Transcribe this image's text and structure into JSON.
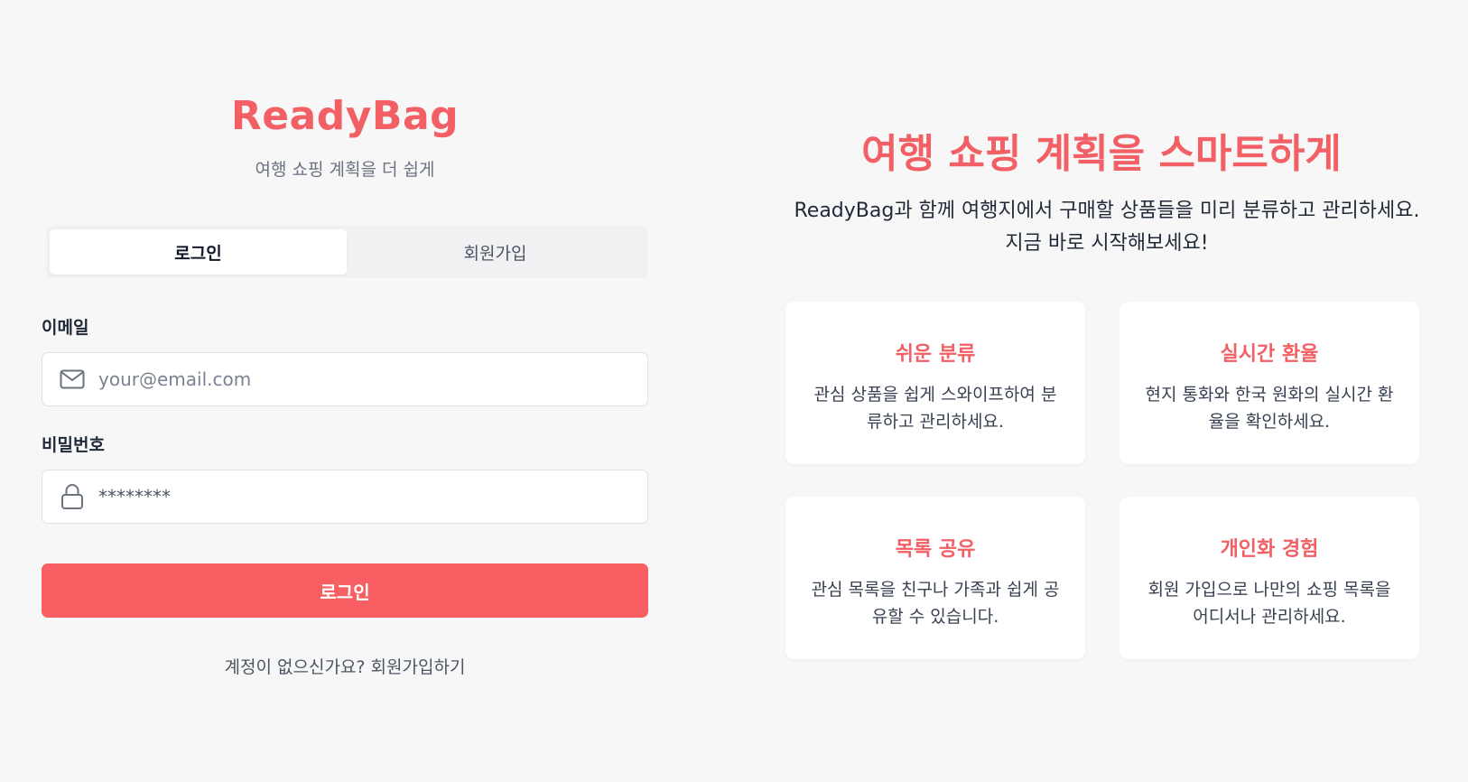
{
  "brand": {
    "name": "ReadyBag",
    "tagline": "여행 쇼핑 계획을 더 쉽게"
  },
  "tabs": [
    {
      "label": "로그인",
      "active": true
    },
    {
      "label": "회원가입",
      "active": false
    }
  ],
  "form": {
    "email_label": "이메일",
    "email_placeholder": "your@email.com",
    "password_label": "비밀번호",
    "password_value": "********",
    "submit_label": "로그인",
    "signup_prompt": "계정이 없으신가요? 회원가입하기"
  },
  "hero": {
    "title": "여행 쇼핑 계획을 스마트하게",
    "description": "ReadyBag과 함께 여행지에서 구매할 상품들을 미리 분류하고 관리하세요. 지금 바로 시작해보세요!"
  },
  "features": [
    {
      "title": "쉬운 분류",
      "description": "관심 상품을 쉽게 스와이프하여 분류하고 관리하세요."
    },
    {
      "title": "실시간 환율",
      "description": "현지 통화와 한국 원화의 실시간 환율을 확인하세요."
    },
    {
      "title": "목록 공유",
      "description": "관심 목록을 친구나 가족과 쉽게 공유할 수 있습니다."
    },
    {
      "title": "개인화 경험",
      "description": "회원 가입으로 나만의 쇼핑 목록을 어디서나 관리하세요."
    }
  ],
  "colors": {
    "accent": "#f25f64",
    "button": "#f85f62",
    "background": "#f7f7f8"
  },
  "icons": {
    "email": "mail-icon",
    "password": "lock-icon"
  }
}
